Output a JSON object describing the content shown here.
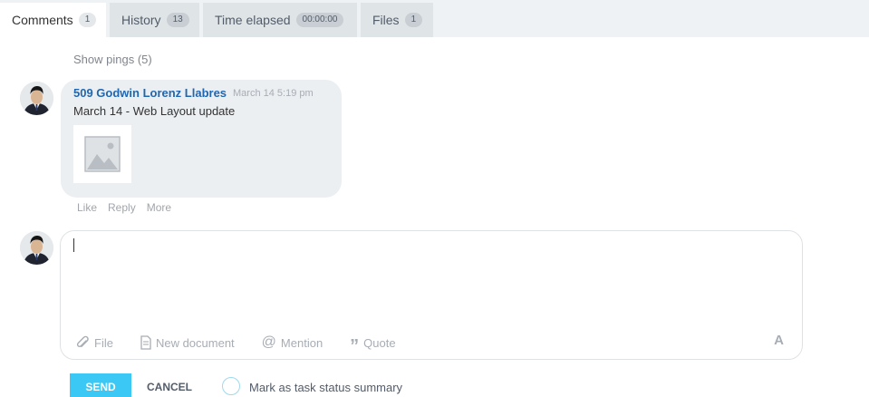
{
  "tabs": [
    {
      "label": "Comments",
      "count": "1"
    },
    {
      "label": "History",
      "count": "13"
    },
    {
      "label": "Time elapsed",
      "count": "00:00:00"
    },
    {
      "label": "Files",
      "count": "1"
    }
  ],
  "show_pings": "Show pings (5)",
  "comment": {
    "author": "509 Godwin Lorenz Llabres",
    "timestamp": "March 14 5:19 pm",
    "text": "March 14 - Web Layout update",
    "attachment_icon": "image-placeholder-icon",
    "actions": [
      "Like",
      "Reply",
      "More"
    ]
  },
  "editor": {
    "tools": [
      {
        "label": "File",
        "icon": "paperclip-icon"
      },
      {
        "label": "New document",
        "icon": "document-icon"
      },
      {
        "label": "Mention",
        "icon": "at-icon"
      },
      {
        "label": "Quote",
        "icon": "quote-icon"
      }
    ],
    "font_button": "A"
  },
  "footer": {
    "send": "SEND",
    "cancel": "CANCEL",
    "mark_summary": "Mark as task status summary"
  },
  "colors": {
    "accent": "#3bc8f5",
    "author_link": "#2067b0",
    "bubble": "#ebeff2"
  }
}
